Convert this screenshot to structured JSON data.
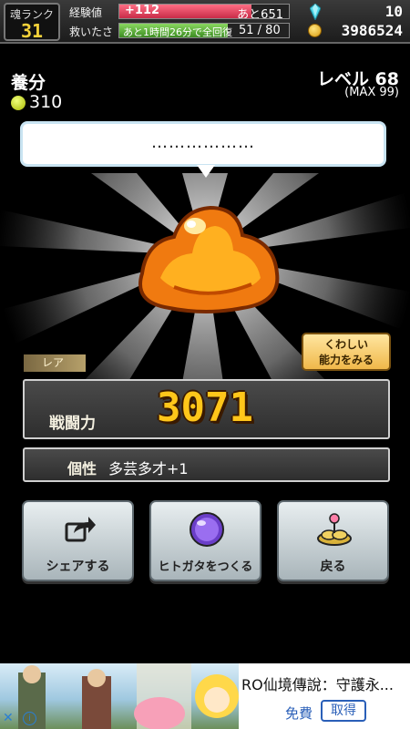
{
  "status": {
    "soul_rank_label": "魂ランク",
    "soul_rank_value": "31",
    "exp_label": "経験値",
    "exp_gain": "+112",
    "exp_remaining": "あと651",
    "exp_fill": 0.78,
    "hunger_label": "救いたさ",
    "hunger_recovery": "あと1時間26分で全回復",
    "hunger_value": "51 / 80",
    "hunger_fill": 0.64,
    "gems": "10",
    "coins": "3986524"
  },
  "nutrient": {
    "label": "養分",
    "value": "310"
  },
  "level": {
    "label": "レベル 68",
    "max": "(MAX 99)"
  },
  "speech": {
    "text": "………………"
  },
  "character": {
    "rarity": "レア",
    "detail_button": [
      "くわしい",
      "能力をみる"
    ],
    "power_label": "戦闘力",
    "power_value": "3071",
    "trait_label": "個性",
    "trait_value": "多芸多才+1"
  },
  "actions": [
    {
      "label": "シェアする",
      "icon": "share-icon"
    },
    {
      "label": "ヒトガタをつくる",
      "icon": "purple-orb-icon"
    },
    {
      "label": "戻る",
      "icon": "return-icon"
    }
  ],
  "ad": {
    "title": "RO仙境傳說：守護永...",
    "free": "免費",
    "get_button": "取得",
    "close": "✕",
    "info": "i"
  },
  "colors": {
    "exp_bar": "#e0405a",
    "hunger_bar": "#5db33a",
    "power_text": "#ffc61a",
    "creature_orange": "#f07a10"
  }
}
